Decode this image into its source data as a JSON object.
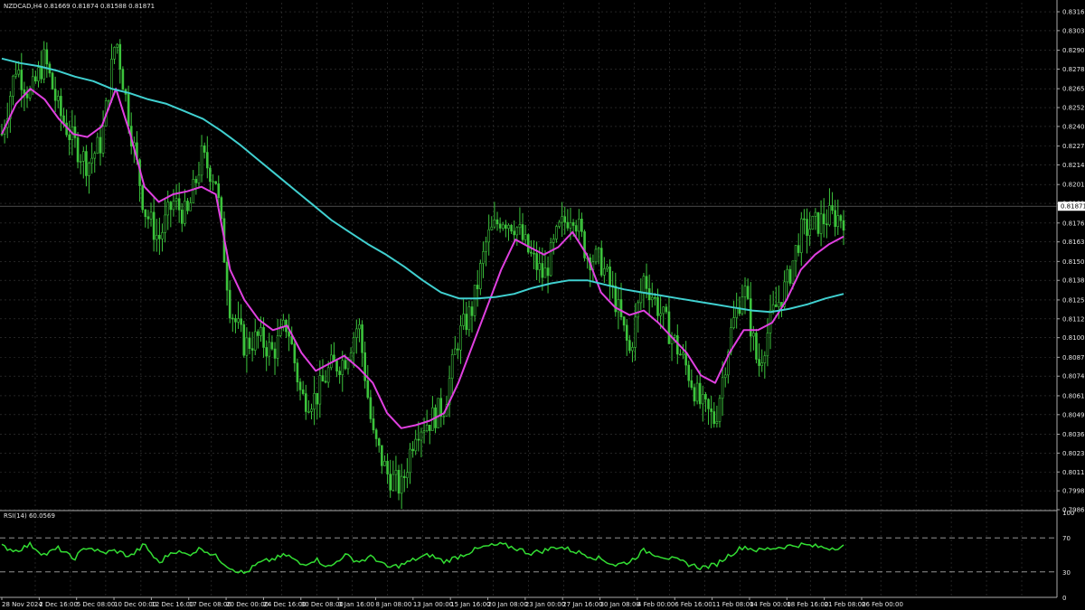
{
  "header": {
    "symbol_info": "NZDCAD,H4  0.81669 0.81874 0.81588 0.81871"
  },
  "rsi_panel": {
    "label": "RSI(14) 60.0569",
    "ticks": [
      "100",
      "70",
      "30",
      "0"
    ],
    "levels": [
      70,
      30
    ]
  },
  "colors": {
    "background": "#000000",
    "grid": "#3a3a3a",
    "candles": "#3cc43c",
    "ma_fast": "#e040e0",
    "ma_slow": "#40d0d0",
    "rsi_line": "#33dd33",
    "axis_text": "#e6e6e6"
  },
  "chart_data": [
    {
      "type": "candlestick",
      "title": "",
      "price_ticks": [
        "0.83160",
        "0.83035",
        "0.82905",
        "0.82780",
        "0.82650",
        "0.82525",
        "0.82400",
        "0.82270",
        "0.82145",
        "0.82015",
        "0.81890",
        "0.81760",
        "0.81635",
        "0.81505",
        "0.81380",
        "0.81250",
        "0.81125",
        "0.81000",
        "0.80870",
        "0.80745",
        "0.80615",
        "0.80490",
        "0.80360",
        "0.80235",
        "0.80110",
        "0.79985",
        "0.79860"
      ],
      "current_price": "0.81871",
      "x_labels": [
        "28 Nov 2024",
        "2 Dec 16:00",
        "5 Dec 08:00",
        "10 Dec 00:00",
        "12 Dec 16:00",
        "17 Dec 08:00",
        "20 Dec 00:00",
        "24 Dec 16:00",
        "30 Dec 08:00",
        "3 Jan 16:00",
        "8 Jan 08:00",
        "13 Jan 00:00",
        "15 Jan 16:00",
        "20 Jan 08:00",
        "23 Jan 00:00",
        "27 Jan 16:00",
        "30 Jan 08:00",
        "4 Feb 00:00",
        "6 Feb 16:00",
        "11 Feb 08:00",
        "14 Feb 00:00",
        "18 Feb 16:00",
        "21 Feb 08:00",
        "26 Feb 00:00"
      ],
      "ylim": [
        0.7986,
        0.8322
      ],
      "grid": true,
      "close_path": [
        0.8235,
        0.828,
        0.826,
        0.8285,
        0.825,
        0.823,
        0.8215,
        0.823,
        0.83,
        0.824,
        0.8185,
        0.8165,
        0.819,
        0.818,
        0.822,
        0.8205,
        0.812,
        0.8095,
        0.81,
        0.809,
        0.811,
        0.806,
        0.806,
        0.808,
        0.8085,
        0.811,
        0.8035,
        0.801,
        0.8,
        0.804,
        0.8045,
        0.8055,
        0.81,
        0.812,
        0.8165,
        0.818,
        0.8175,
        0.8155,
        0.814,
        0.817,
        0.8185,
        0.8155,
        0.815,
        0.8125,
        0.809,
        0.814,
        0.812,
        0.81,
        0.808,
        0.8055,
        0.8045,
        0.81,
        0.8135,
        0.808,
        0.8115,
        0.8135,
        0.817,
        0.8175,
        0.818,
        0.818
      ],
      "series": [
        {
          "name": "",
          "kind": "ma_fast",
          "values": [
            0.8235,
            0.8255,
            0.8265,
            0.8258,
            0.8245,
            0.8235,
            0.8233,
            0.824,
            0.8265,
            0.8235,
            0.82,
            0.819,
            0.8195,
            0.8197,
            0.82,
            0.8195,
            0.8145,
            0.8125,
            0.8112,
            0.8105,
            0.8108,
            0.809,
            0.8078,
            0.8083,
            0.8088,
            0.808,
            0.807,
            0.805,
            0.804,
            0.8042,
            0.8045,
            0.805,
            0.807,
            0.8095,
            0.812,
            0.8145,
            0.8165,
            0.816,
            0.8155,
            0.816,
            0.817,
            0.8155,
            0.813,
            0.812,
            0.8115,
            0.8118,
            0.811,
            0.81,
            0.809,
            0.8075,
            0.807,
            0.809,
            0.8105,
            0.8105,
            0.811,
            0.8125,
            0.8145,
            0.8155,
            0.8162,
            0.8167
          ]
        },
        {
          "name": "",
          "kind": "ma_slow",
          "values": [
            0.8285,
            0.8282,
            0.828,
            0.8277,
            0.8273,
            0.827,
            0.8265,
            0.8262,
            0.8258,
            0.8255,
            0.825,
            0.8245,
            0.8237,
            0.8228,
            0.8218,
            0.8208,
            0.8198,
            0.8188,
            0.8178,
            0.817,
            0.8162,
            0.8155,
            0.8147,
            0.8138,
            0.813,
            0.8126,
            0.8126,
            0.8127,
            0.8129,
            0.8133,
            0.8136,
            0.8138,
            0.8138,
            0.8135,
            0.8132,
            0.813,
            0.8128,
            0.8126,
            0.8124,
            0.8122,
            0.812,
            0.8118,
            0.8117,
            0.8119,
            0.8122,
            0.8126,
            0.8129
          ]
        }
      ]
    },
    {
      "type": "line",
      "title": "RSI(14)",
      "ylim": [
        0,
        100
      ],
      "levels": [
        70,
        30
      ],
      "series": [
        {
          "name": "RSI(14)",
          "values": [
            60,
            55,
            62,
            50,
            58,
            45,
            60,
            52,
            55,
            48,
            62,
            40,
            55,
            50,
            58,
            48,
            35,
            28,
            40,
            45,
            50,
            38,
            45,
            35,
            50,
            42,
            48,
            35,
            38,
            45,
            50,
            42,
            48,
            55,
            60,
            62,
            58,
            52,
            55,
            60,
            55,
            50,
            45,
            38,
            42,
            55,
            50,
            45,
            40,
            35,
            38,
            50,
            60,
            55,
            58,
            60,
            62,
            60,
            58,
            60
          ]
        }
      ]
    }
  ]
}
